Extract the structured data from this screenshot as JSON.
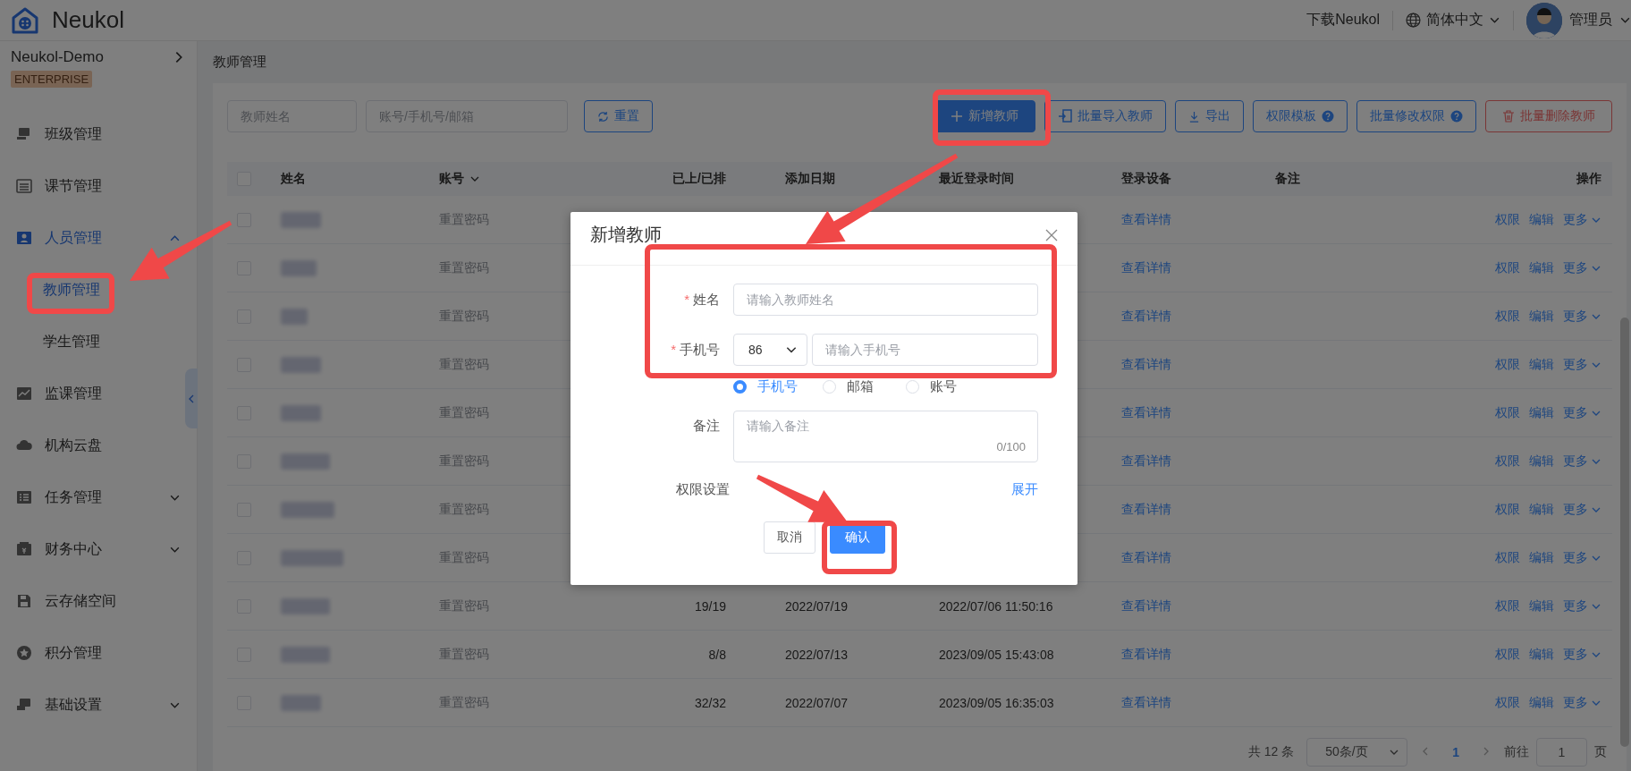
{
  "app": {
    "logo_text": "Neukol"
  },
  "header": {
    "download": "下载Neukol",
    "language": "简体中文",
    "user": "管理员"
  },
  "sidebar": {
    "org": "Neukol-Demo",
    "edition": "ENTERPRISE",
    "items": [
      {
        "label": "班级管理",
        "kind": "link",
        "selected": false
      },
      {
        "label": "课节管理",
        "kind": "link",
        "selected": false
      },
      {
        "label": "人员管理",
        "kind": "group",
        "selected": true,
        "expanded": true,
        "children": [
          {
            "label": "教师管理",
            "selected": true
          },
          {
            "label": "学生管理",
            "selected": false
          }
        ]
      },
      {
        "label": "监课管理",
        "kind": "link",
        "selected": false
      },
      {
        "label": "机构云盘",
        "kind": "link",
        "selected": false
      },
      {
        "label": "任务管理",
        "kind": "group",
        "selected": false,
        "expanded": false
      },
      {
        "label": "财务中心",
        "kind": "group",
        "selected": false,
        "expanded": false
      },
      {
        "label": "云存储空间",
        "kind": "link",
        "selected": false
      },
      {
        "label": "积分管理",
        "kind": "link",
        "selected": false
      },
      {
        "label": "基础设置",
        "kind": "group",
        "selected": false,
        "expanded": false
      }
    ]
  },
  "breadcrumb": "教师管理",
  "filters": [
    {
      "placeholder": "教师姓名"
    },
    {
      "placeholder": "账号/手机号/邮箱"
    }
  ],
  "reset_button": "重置",
  "actions": [
    {
      "label": "新增教师",
      "kind": "primary",
      "help": false
    },
    {
      "label": "批量导入教师",
      "kind": "outline",
      "help": false
    },
    {
      "label": "导出",
      "kind": "outline",
      "help": false
    },
    {
      "label": "权限模板",
      "kind": "outline",
      "help": true
    },
    {
      "label": "批量修改权限",
      "kind": "outline",
      "help": true
    },
    {
      "label": "批量删除教师",
      "kind": "danger",
      "help": false
    }
  ],
  "table": {
    "select_all": false,
    "columns": [
      {
        "label": "姓名",
        "sortable": false
      },
      {
        "label": "账号",
        "sortable": true
      },
      {
        "label": "已上/已排",
        "sortable": false
      },
      {
        "label": "添加日期",
        "sortable": false
      },
      {
        "label": "最近登录时间",
        "sortable": false
      },
      {
        "label": "登录设备",
        "sortable": false
      },
      {
        "label": "备注",
        "sortable": false
      },
      {
        "label": "操作",
        "sortable": false
      }
    ],
    "rows": [
      {
        "checked": false,
        "account_action": "重置密码",
        "device": "查看详情",
        "actions": [
          "权限",
          "编辑",
          "更多"
        ]
      },
      {
        "checked": false,
        "account_action": "重置密码",
        "device": "查看详情",
        "actions": [
          "权限",
          "编辑",
          "更多"
        ]
      },
      {
        "checked": false,
        "account_action": "重置密码",
        "device": "查看详情",
        "actions": [
          "权限",
          "编辑",
          "更多"
        ]
      },
      {
        "checked": false,
        "account_action": "重置密码",
        "device": "查看详情",
        "actions": [
          "权限",
          "编辑",
          "更多"
        ]
      },
      {
        "checked": false,
        "account_action": "重置密码",
        "device": "查看详情",
        "actions": [
          "权限",
          "编辑",
          "更多"
        ]
      },
      {
        "checked": false,
        "account_action": "重置密码",
        "device": "查看详情",
        "actions": [
          "权限",
          "编辑",
          "更多"
        ]
      },
      {
        "checked": false,
        "account_action": "重置密码",
        "device": "查看详情",
        "actions": [
          "权限",
          "编辑",
          "更多"
        ]
      },
      {
        "checked": false,
        "account_action": "重置密码",
        "device": "查看详情",
        "actions": [
          "权限",
          "编辑",
          "更多"
        ]
      },
      {
        "checked": false,
        "account_action": "重置密码",
        "lessons": "19/19",
        "added": "2022/07/19",
        "last_login": "2022/07/06 11:50:16",
        "device": "查看详情",
        "actions": [
          "权限",
          "编辑",
          "更多"
        ]
      },
      {
        "checked": false,
        "account_action": "重置密码",
        "lessons": "8/8",
        "added": "2022/07/13",
        "last_login": "2023/09/05 15:43:08",
        "device": "查看详情",
        "actions": [
          "权限",
          "编辑",
          "更多"
        ]
      },
      {
        "checked": false,
        "account_action": "重置密码",
        "lessons": "32/32",
        "added": "2022/07/07",
        "last_login": "2023/09/05 16:35:03",
        "device": "查看详情",
        "actions": [
          "权限",
          "编辑",
          "更多"
        ]
      }
    ]
  },
  "pagination": {
    "total": "共 12 条",
    "page_size": "50条/页",
    "pages": [
      {
        "label": "1",
        "selected": true
      }
    ],
    "goto_label": "前往",
    "goto_value": "1",
    "goto_suffix": "页"
  },
  "modal": {
    "title": "新增教师",
    "fields": [
      {
        "label": "姓名",
        "required_mark": "*",
        "kind": "text",
        "placeholder": "请输入教师姓名"
      },
      {
        "label": "手机号",
        "required_mark": "*",
        "kind": "phone",
        "code": "86",
        "placeholder": "请输入手机号"
      }
    ],
    "contact_types": [
      {
        "label": "手机号",
        "selected": true
      },
      {
        "label": "邮箱",
        "selected": false
      },
      {
        "label": "账号",
        "selected": false
      }
    ],
    "note": {
      "label": "备注",
      "placeholder": "请输入备注",
      "counter": "0/100"
    },
    "permissions": {
      "label": "权限设置",
      "toggle": "展开"
    },
    "buttons": [
      {
        "label": "取消",
        "kind": "default"
      },
      {
        "label": "确认",
        "kind": "primary"
      }
    ]
  }
}
